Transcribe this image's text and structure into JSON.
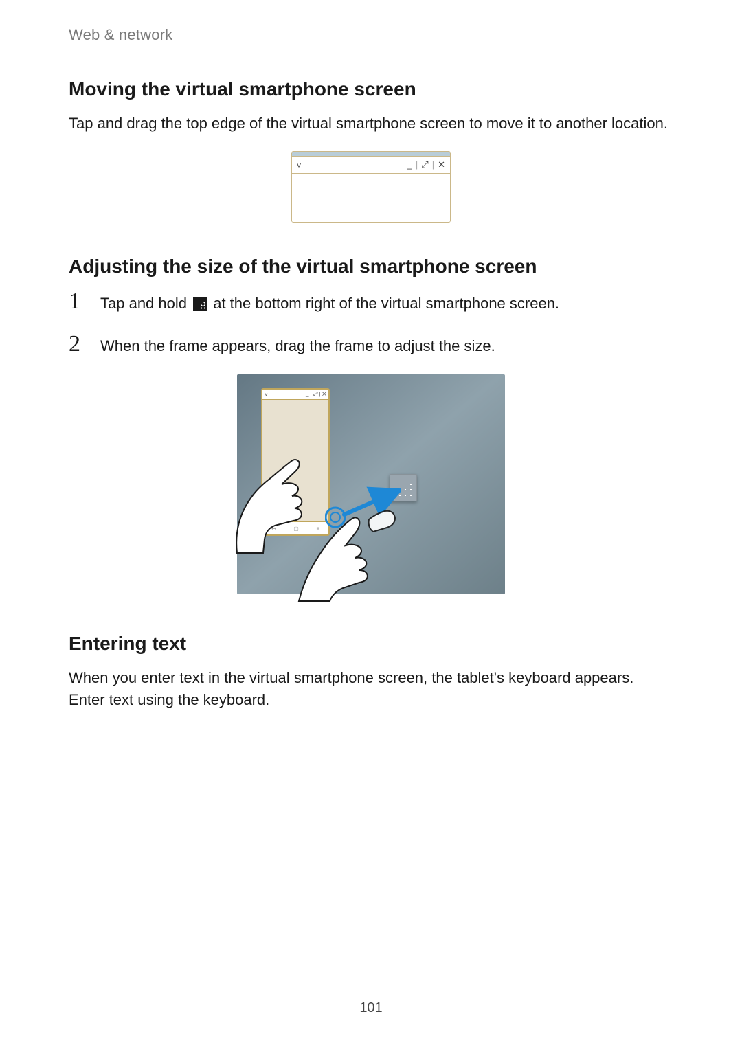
{
  "chapter": "Web & network",
  "section1": {
    "title": "Moving the virtual smartphone screen",
    "body": "Tap and drag the top edge of the virtual smartphone screen to move it to another location."
  },
  "figure1": {
    "chevron": "˅",
    "min": "_",
    "max": "⤢",
    "close": "✕",
    "divider": "|"
  },
  "section2": {
    "title": "Adjusting the size of the virtual smartphone screen",
    "step1_num": "1",
    "step1_a": "Tap and hold ",
    "step1_b": " at the bottom right of the virtual smartphone screen.",
    "step2_num": "2",
    "step2": "When the frame appears, drag the frame to adjust the size."
  },
  "figure2": {
    "mini_chev": "˅",
    "mini_icons": "_ | ⤢ | ✕",
    "nav_back": "↤",
    "nav_home": "▢",
    "nav_recent": "≡"
  },
  "section3": {
    "title": "Entering text",
    "body": "When you enter text in the virtual smartphone screen, the tablet's keyboard appears. Enter text using the keyboard."
  },
  "page_number": "101"
}
